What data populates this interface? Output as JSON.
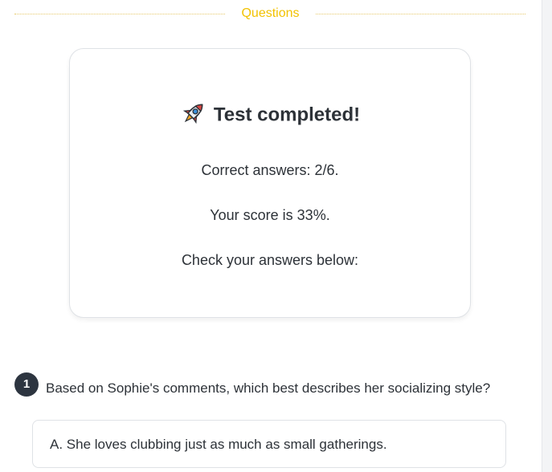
{
  "section": {
    "label": "Questions"
  },
  "result": {
    "title": "Test completed!",
    "icon": "rocket-icon",
    "correct_answers": "Correct answers: 2/6.",
    "score": "Your score is 33%.",
    "check": "Check your answers below:"
  },
  "questions": [
    {
      "number": "1",
      "text": "Based on Sophie's comments, which best describes her socializing style?",
      "options": [
        {
          "text": "A. She loves clubbing just as much as small gatherings."
        }
      ]
    }
  ],
  "colors": {
    "accent": "#f2c200",
    "text": "#2d3238",
    "badge": "#2d3540"
  }
}
